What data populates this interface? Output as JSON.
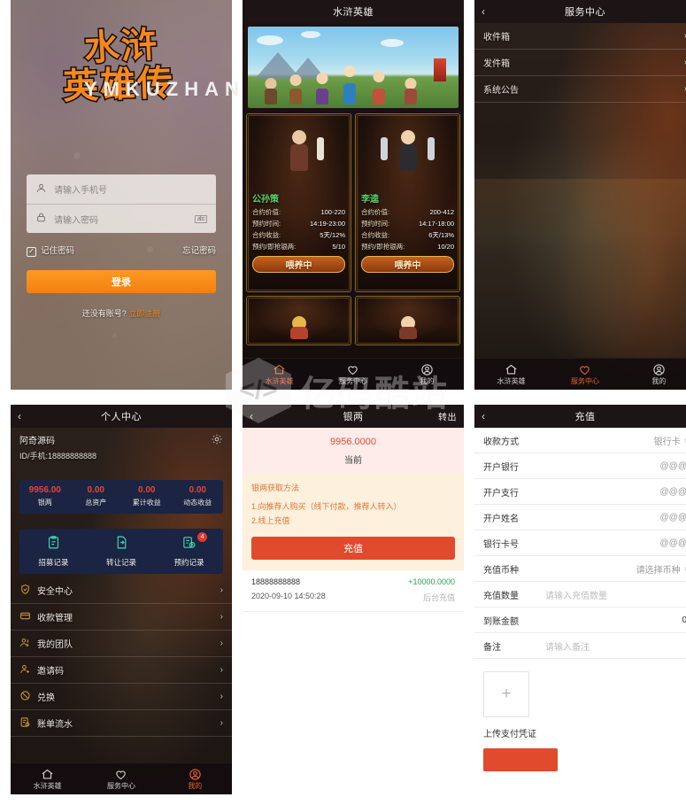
{
  "app": {
    "brand": "水浒英雄传"
  },
  "watermark": {
    "cn": "亿码酷站",
    "en": "YMKUZHAN",
    "mark": "</>"
  },
  "login": {
    "logo_line1": "水浒",
    "logo_line2": "英雄传",
    "phone_placeholder": "请输入手机号",
    "password_placeholder": "请输入密码",
    "eye_tag": "abc",
    "remember_label": "记住密码",
    "remember_checked": "✓",
    "forgot_label": "忘记密码",
    "login_button": "登录",
    "register_prefix": "还没有账号?",
    "register_link": "立即注册"
  },
  "home": {
    "title": "水浒英雄",
    "cards": [
      {
        "name": "公孙策",
        "rows": [
          {
            "label": "合约价值:",
            "value": "100-220"
          },
          {
            "label": "预约时间:",
            "value": "14:19-23:00"
          },
          {
            "label": "合约收益:",
            "value": "5天/12%"
          },
          {
            "label": "预约/即抢银两:",
            "value": "5/10"
          }
        ],
        "button": "喂养中"
      },
      {
        "name": "李逵",
        "rows": [
          {
            "label": "合约价值:",
            "value": "200-412"
          },
          {
            "label": "预约时间:",
            "value": "14:17-18:00"
          },
          {
            "label": "合约收益:",
            "value": "6天/13%"
          },
          {
            "label": "预约/即抢银两:",
            "value": "10/20"
          }
        ],
        "button": "喂养中"
      }
    ]
  },
  "service": {
    "title": "服务中心",
    "back": "‹",
    "items": [
      {
        "label": "收件箱",
        "chevron": "›"
      },
      {
        "label": "发件箱",
        "chevron": "›"
      },
      {
        "label": "系统公告",
        "chevron": "›"
      }
    ]
  },
  "profile": {
    "title": "个人中心",
    "back": "‹",
    "username": "阿奇源码",
    "user_id": "ID/手机:18888888888",
    "stats": [
      {
        "num": "9956.00",
        "label": "银两"
      },
      {
        "num": "0.00",
        "label": "总资产"
      },
      {
        "num": "0.00",
        "label": "累计收益"
      },
      {
        "num": "0.00",
        "label": "动态收益"
      }
    ],
    "quick_actions": [
      {
        "label": "招募记录",
        "badge": ""
      },
      {
        "label": "转让记录",
        "badge": ""
      },
      {
        "label": "预约记录",
        "badge": "4"
      }
    ],
    "menu": [
      {
        "label": "安全中心",
        "chevron": "›",
        "icon": "shield-icon"
      },
      {
        "label": "收款管理",
        "chevron": "›",
        "icon": "card-icon"
      },
      {
        "label": "我的团队",
        "chevron": "›",
        "icon": "team-icon"
      },
      {
        "label": "邀请码",
        "chevron": "›",
        "icon": "person-add-icon"
      },
      {
        "label": "兑换",
        "chevron": "›",
        "icon": "exchange-icon"
      },
      {
        "label": "账单流水",
        "chevron": "›",
        "icon": "bill-icon"
      }
    ]
  },
  "silver": {
    "title": "银两",
    "back": "‹",
    "transfer_out": "转出",
    "balance": "9956.0000",
    "balance_label": "当前",
    "info_title": "银两获取方法",
    "info_lines": [
      "1.向推荐人购买（线下付款，推荐人转入）",
      "2.线上充值"
    ],
    "recharge_button": "充值",
    "transactions": [
      {
        "account": "18888888888",
        "time": "2020-09-10 14:50:28",
        "amount": "+10000.0000",
        "type": "后台充值"
      }
    ]
  },
  "recharge": {
    "title": "充值",
    "back": "‹",
    "fields": [
      {
        "label": "收款方式",
        "value": "银行卡",
        "chevron": "›",
        "kind": "select"
      },
      {
        "label": "开户银行",
        "value": "@@@",
        "kind": "value"
      },
      {
        "label": "开户支行",
        "value": "@@@",
        "kind": "value"
      },
      {
        "label": "开户姓名",
        "value": "@@@",
        "kind": "value"
      },
      {
        "label": "银行卡号",
        "value": "@@@",
        "kind": "value"
      },
      {
        "label": "充值币种",
        "value": "请选择币种",
        "chevron": "›",
        "kind": "select"
      },
      {
        "label": "充值数量",
        "placeholder": "请输入充值数量",
        "kind": "input"
      },
      {
        "label": "到账金额",
        "value": "0",
        "kind": "value"
      },
      {
        "label": "备注",
        "placeholder": "请输入备注",
        "kind": "input"
      }
    ],
    "upload_plus": "+",
    "upload_label": "上传支付凭证",
    "submit_label": ""
  },
  "tabbar": {
    "items": [
      {
        "label": "水浒英雄",
        "icon": "home-icon"
      },
      {
        "label": "服务中心",
        "icon": "heart-icon"
      },
      {
        "label": "我的",
        "icon": "user-icon"
      }
    ]
  },
  "colors": {
    "accent_orange": "#f5881f",
    "accent_red": "#df4b2c",
    "hero_green": "#5ed16a",
    "dark_header": "#1d1416",
    "panel_navy": "#1b2442"
  }
}
